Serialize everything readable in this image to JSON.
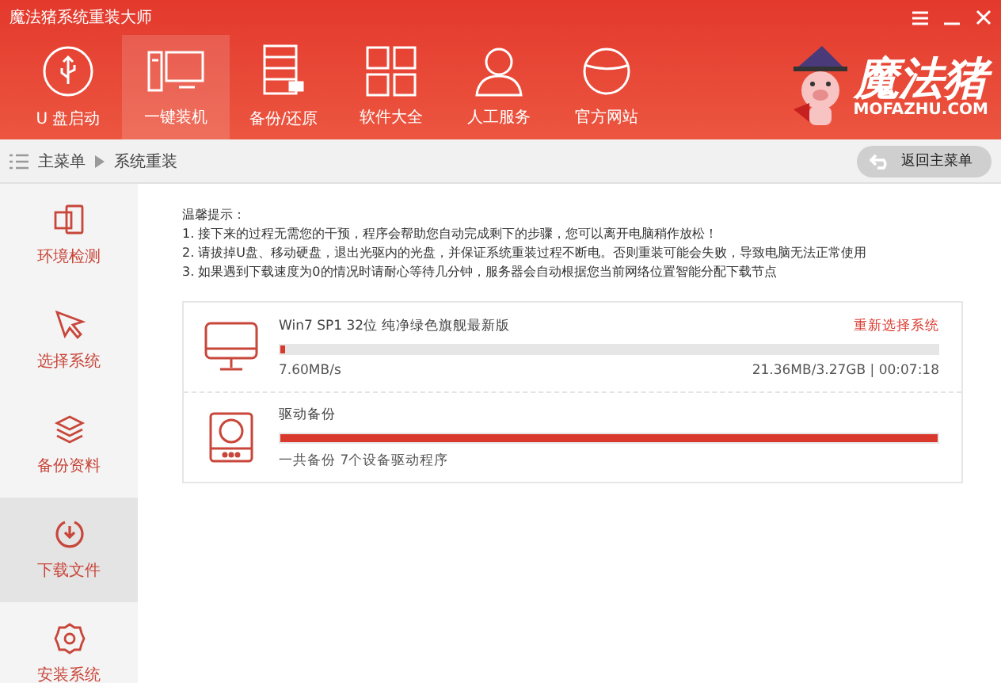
{
  "window": {
    "title": "魔法猪系统重装大师"
  },
  "nav": [
    {
      "label": "U 盘启动",
      "selected": false
    },
    {
      "label": "一键装机",
      "selected": true
    },
    {
      "label": "备份/还原",
      "selected": false
    },
    {
      "label": "软件大全",
      "selected": false
    },
    {
      "label": "人工服务",
      "selected": false
    },
    {
      "label": "官方网站",
      "selected": false
    }
  ],
  "logo": {
    "name": "魔法猪",
    "site": "MOFAZHU.COM"
  },
  "breadcrumb": [
    "主菜单",
    "系统重装"
  ],
  "back_button": "返回主菜单",
  "sidebar": [
    {
      "label": "环境检测",
      "selected": false
    },
    {
      "label": "选择系统",
      "selected": false
    },
    {
      "label": "备份资料",
      "selected": false
    },
    {
      "label": "下载文件",
      "selected": true
    },
    {
      "label": "安装系统",
      "selected": false
    }
  ],
  "tips": [
    "温馨提示：",
    "1. 接下来的过程无需您的干预，程序会帮助您自动完成剩下的步骤，您可以离开电脑稍作放松！",
    "2. 请拔掉U盘、移动硬盘，退出光驱内的光盘，并保证系统重装过程不断电。否则重装可能会失败，导致电脑无法正常使用",
    "3. 如果遇到下载速度为0的情况时请耐心等待几分钟，服务器会自动根据您当前网络位置智能分配下载节点"
  ],
  "tasks": [
    {
      "kind": "system",
      "title": "Win7 SP1 32位 纯净绿色旗舰最新版",
      "action": "重新选择系统",
      "level": 0.007,
      "speed": "7.60MB/s",
      "progress": "21.36MB/3.27GB | 00:07:18"
    },
    {
      "kind": "driver",
      "title": "驱动备份",
      "level": 1,
      "speed": "一共备份 7个设备驱动程序"
    }
  ]
}
